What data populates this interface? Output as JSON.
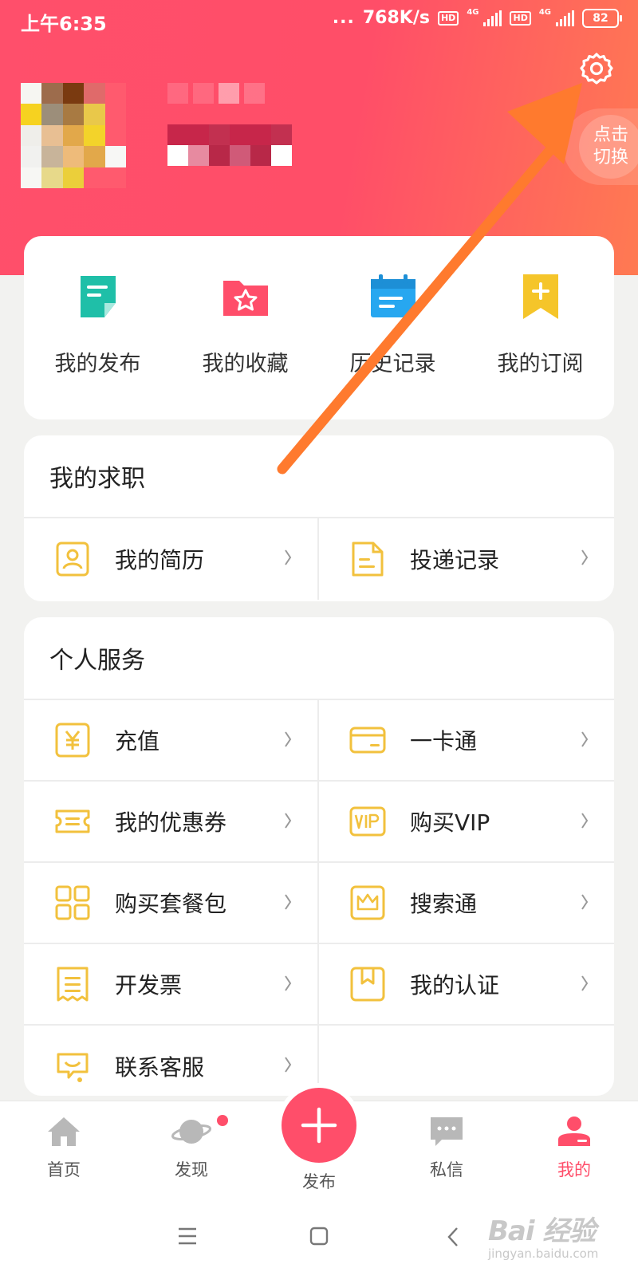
{
  "status_bar": {
    "time": "上午6:35",
    "dots": "...",
    "speed": "768K/s",
    "hd1": "HD",
    "hd2": "HD",
    "net1": "4G",
    "net2": "4G",
    "battery": "82"
  },
  "header": {
    "switch_label": "点击切换",
    "settings_icon": "gear-icon"
  },
  "quick_actions": [
    {
      "label": "我的发布",
      "icon": "document-icon",
      "color": "#1fbfa8"
    },
    {
      "label": "我的收藏",
      "icon": "folder-star-icon",
      "color": "#ff4e6a"
    },
    {
      "label": "历史记录",
      "icon": "calendar-icon",
      "color": "#27a7f0"
    },
    {
      "label": "我的订阅",
      "icon": "bookmark-plus-icon",
      "color": "#f5c52a"
    }
  ],
  "job_section": {
    "title": "我的求职",
    "items": [
      {
        "label": "我的简历",
        "icon": "resume-icon"
      },
      {
        "label": "投递记录",
        "icon": "file-record-icon"
      }
    ]
  },
  "service_section": {
    "title": "个人服务",
    "items": [
      {
        "label": "充值",
        "icon": "yuan-icon"
      },
      {
        "label": "一卡通",
        "icon": "card-icon"
      },
      {
        "label": "我的优惠券",
        "icon": "coupon-icon"
      },
      {
        "label": "购买VIP",
        "icon": "vip-icon"
      },
      {
        "label": "购买套餐包",
        "icon": "grid-package-icon"
      },
      {
        "label": "搜索通",
        "icon": "crown-icon"
      },
      {
        "label": "开发票",
        "icon": "invoice-icon"
      },
      {
        "label": "我的认证",
        "icon": "certification-icon"
      },
      {
        "label": "联系客服",
        "icon": "customer-service-icon"
      }
    ]
  },
  "bottom_nav": {
    "items": [
      {
        "label": "首页",
        "icon": "home-icon"
      },
      {
        "label": "发现",
        "icon": "planet-icon"
      },
      {
        "label": "发布",
        "icon": "plus-icon"
      },
      {
        "label": "私信",
        "icon": "message-icon"
      },
      {
        "label": "我的",
        "icon": "user-icon"
      }
    ],
    "active": "我的",
    "accent": "#ff4e6a"
  },
  "watermark": {
    "main": "Bai 经验",
    "sub": "jingyan.baidu.com"
  },
  "colors": {
    "brand": "#ff4e6a",
    "icon_yellow": "#f2c13d",
    "annotation_arrow": "#ff7a2e"
  }
}
